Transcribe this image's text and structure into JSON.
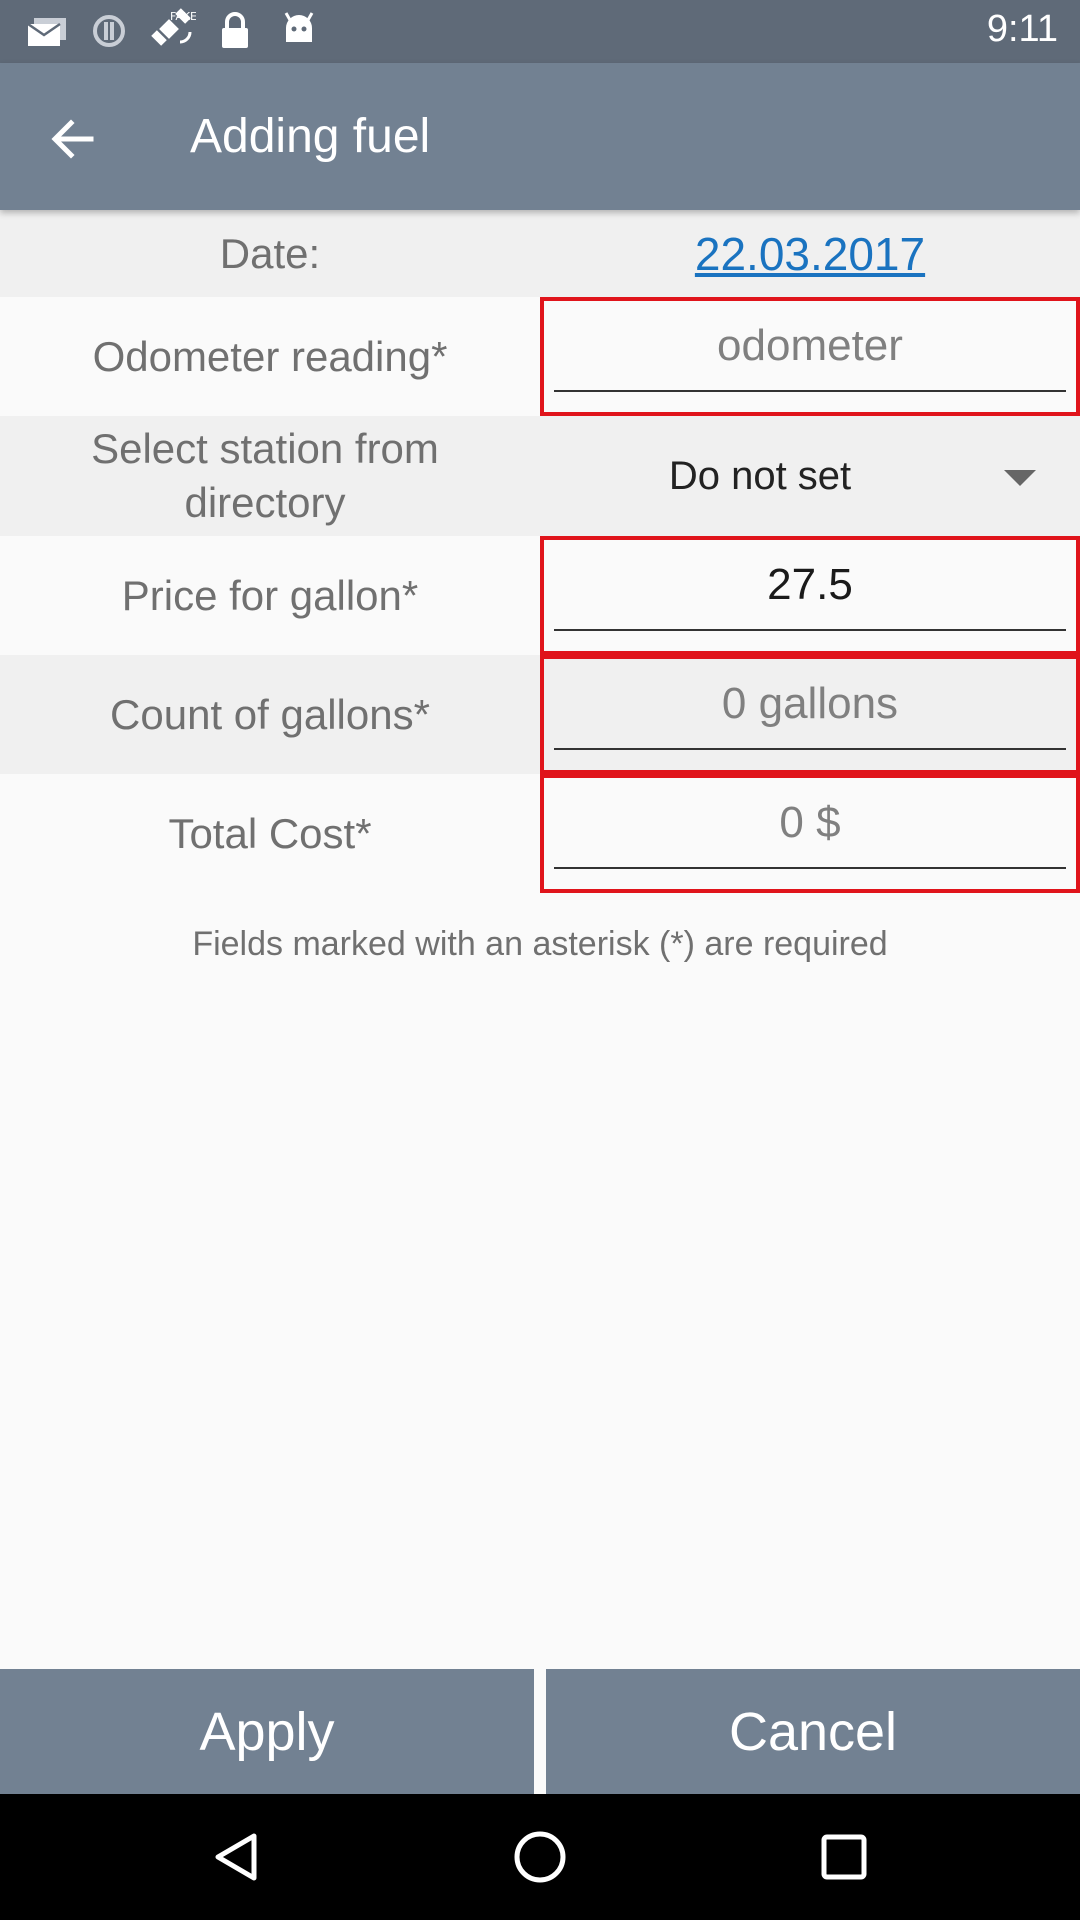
{
  "status_bar": {
    "time": "9:11",
    "icons": [
      "email-icon",
      "alert-icon",
      "fake-gps-icon",
      "lock-icon",
      "android-icon"
    ]
  },
  "app_bar": {
    "title": "Adding fuel",
    "back_icon": "arrow-back-icon"
  },
  "form": {
    "date": {
      "label": "Date:",
      "value": "22.03.2017"
    },
    "odometer": {
      "label": "Odometer reading*",
      "value": "",
      "placeholder": "odometer"
    },
    "station": {
      "label": "Select station from directory",
      "selected": "Do not set"
    },
    "price": {
      "label": "Price for gallon*",
      "value": "27.5",
      "placeholder": ""
    },
    "count": {
      "label": "Count of gallons*",
      "value": "",
      "placeholder": "0 gallons"
    },
    "total": {
      "label": "Total Cost*",
      "value": "",
      "placeholder": "0 $"
    },
    "hint": "Fields marked with an asterisk (*) are required"
  },
  "buttons": {
    "apply": "Apply",
    "cancel": "Cancel"
  },
  "colors": {
    "app_bar": "#728192",
    "status_bar": "#5f6a78",
    "error_border": "#e0141b",
    "link": "#1a73c0"
  }
}
